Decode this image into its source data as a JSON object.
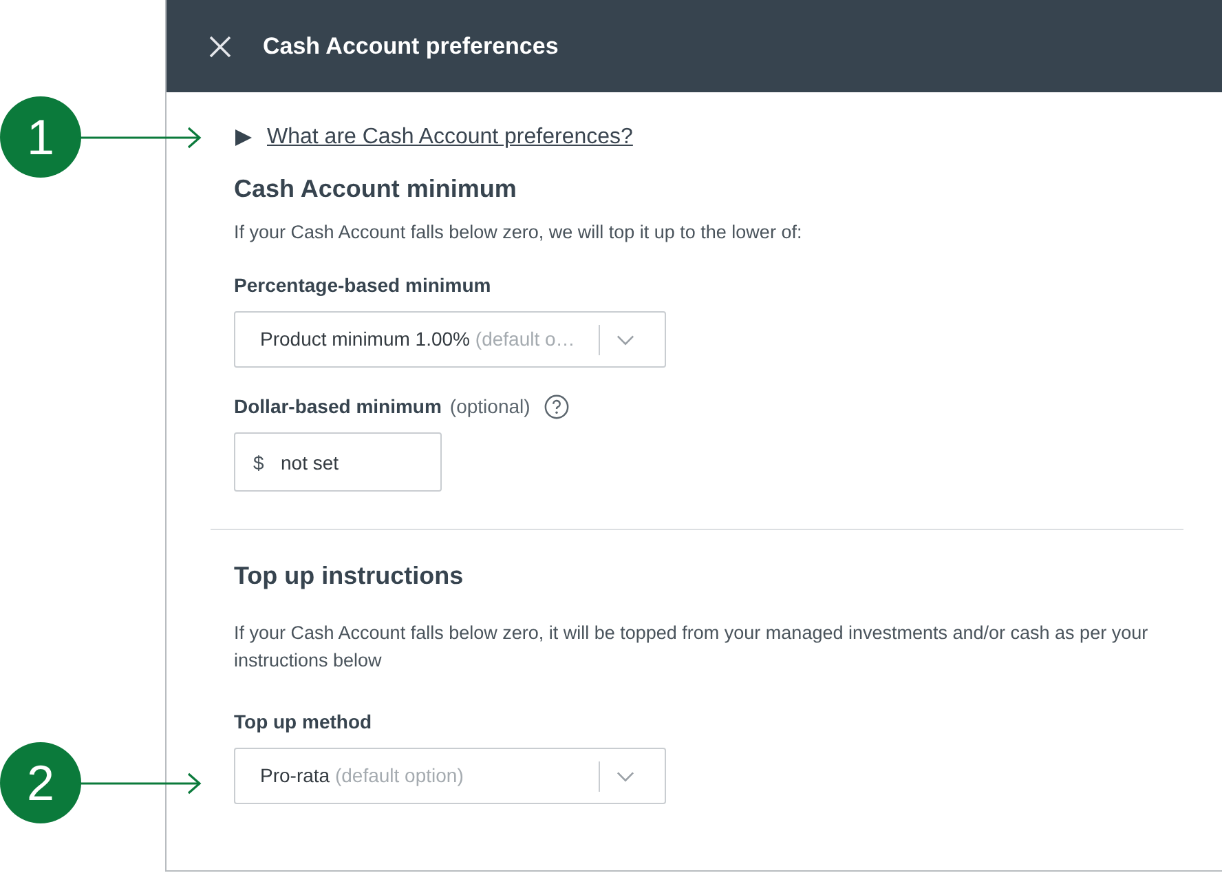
{
  "panel": {
    "title": "Cash Account preferences"
  },
  "help_link": {
    "label": "What are Cash Account preferences?",
    "expanded": false
  },
  "sections": [
    {
      "heading": "Cash Account minimum",
      "description": "If your Cash Account falls below zero, we will top it up to the lower of:",
      "fields": [
        {
          "kind": "select",
          "label": "Percentage-based minimum",
          "value": "Product minimum 1.00%",
          "hint": "(default o…"
        },
        {
          "kind": "amount",
          "label": "Dollar-based minimum",
          "note": "(optional)",
          "prefix": "$",
          "placeholder": "not set"
        }
      ]
    },
    {
      "heading": "Top up instructions",
      "description": "If your Cash Account falls below zero, it will be topped from your managed investments and/or cash as per your instructions below",
      "fields": [
        {
          "kind": "select",
          "label": "Top up method",
          "value": "Pro-rata",
          "hint": "(default option)"
        }
      ]
    }
  ],
  "callouts": [
    {
      "number": "1"
    },
    {
      "number": "2"
    }
  ]
}
